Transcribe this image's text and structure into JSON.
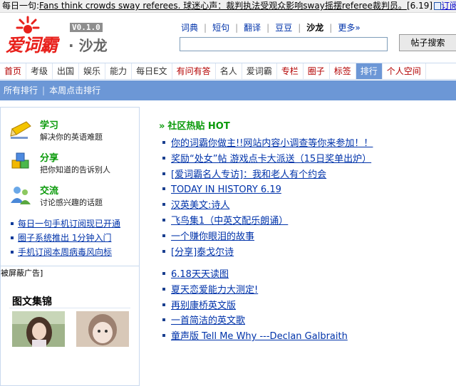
{
  "ticker": {
    "label": "每日一句:",
    "text": "Fans think crowds sway referees. 球迷心声：裁判执法受观众影响sway摇摆referee裁判员。",
    "date": "[6.19]",
    "subscribe": "订阅"
  },
  "header": {
    "logo_text": "爱词霸",
    "logo_dot": "·",
    "logo_sub": "沙龙",
    "version": "V0.1.0",
    "links": [
      "词典",
      "短句",
      "翻译",
      "豆豆",
      "沙龙",
      "更多»"
    ],
    "active_link": "沙龙",
    "search_value": "",
    "search_button": "帖子搜索"
  },
  "main_nav": {
    "items": [
      {
        "label": "首页",
        "style": "red"
      },
      {
        "label": "考级",
        "style": "normal"
      },
      {
        "label": "出国",
        "style": "normal"
      },
      {
        "label": "娱乐",
        "style": "normal"
      },
      {
        "label": "能力",
        "style": "normal"
      },
      {
        "label": "每日E文",
        "style": "normal"
      },
      {
        "label": "有问有答",
        "style": "red"
      },
      {
        "label": "名人",
        "style": "normal"
      },
      {
        "label": "爱词霸",
        "style": "normal"
      },
      {
        "label": "专栏",
        "style": "red"
      },
      {
        "label": "圈子",
        "style": "red"
      },
      {
        "label": "标签",
        "style": "red"
      },
      {
        "label": "排行",
        "style": "active"
      },
      {
        "label": "个人空间",
        "style": "red"
      }
    ]
  },
  "sub_nav": {
    "items": [
      "所有排行",
      "本周点击排行"
    ],
    "separator": "|"
  },
  "sidebar": {
    "features": [
      {
        "title": "学习",
        "desc": "解决你的英语难题",
        "icon": "pencil-icon"
      },
      {
        "title": "分享",
        "desc": "把你知道的告诉别人",
        "icon": "cubes-icon"
      },
      {
        "title": "交流",
        "desc": "讨论感兴趣的话题",
        "icon": "people-icon"
      }
    ],
    "promos": [
      "每日一句手机订阅现已开通",
      "圈子系统推出 1分钟入门",
      "手机订阅本周病毒风向标"
    ],
    "ad_blocked": "被屏蔽广告]",
    "gallery_title": "图文集锦"
  },
  "hot": {
    "heading": "社区热贴  HOT",
    "arrow": "»",
    "group1": [
      "你的词霸你做主!!网站内容小调查等你来参加！！",
      "奖励“处女”帖  游戏点卡大派送（15日奖单出炉）",
      "[爱词霸名人专访]：我和老人有个约会",
      "TODAY IN HISTORY 6.19",
      "汉英美文:诗人",
      "飞鸟集1（中英文配乐朗诵）",
      "一个赚你眼泪的故事",
      "[分享]泰戈尔诗"
    ],
    "group2": [
      "6.18天天读图",
      "夏天恋爱能力大测定!",
      "再别康桥英文版",
      "一首简洁的英文歌",
      "童声版  Tell Me Why ---Declan Galbraith"
    ]
  },
  "colors": {
    "nav_blue": "#6c97d6",
    "link_blue": "#0033aa",
    "green": "#0a9a0a",
    "logo_red": "#e8211c"
  }
}
